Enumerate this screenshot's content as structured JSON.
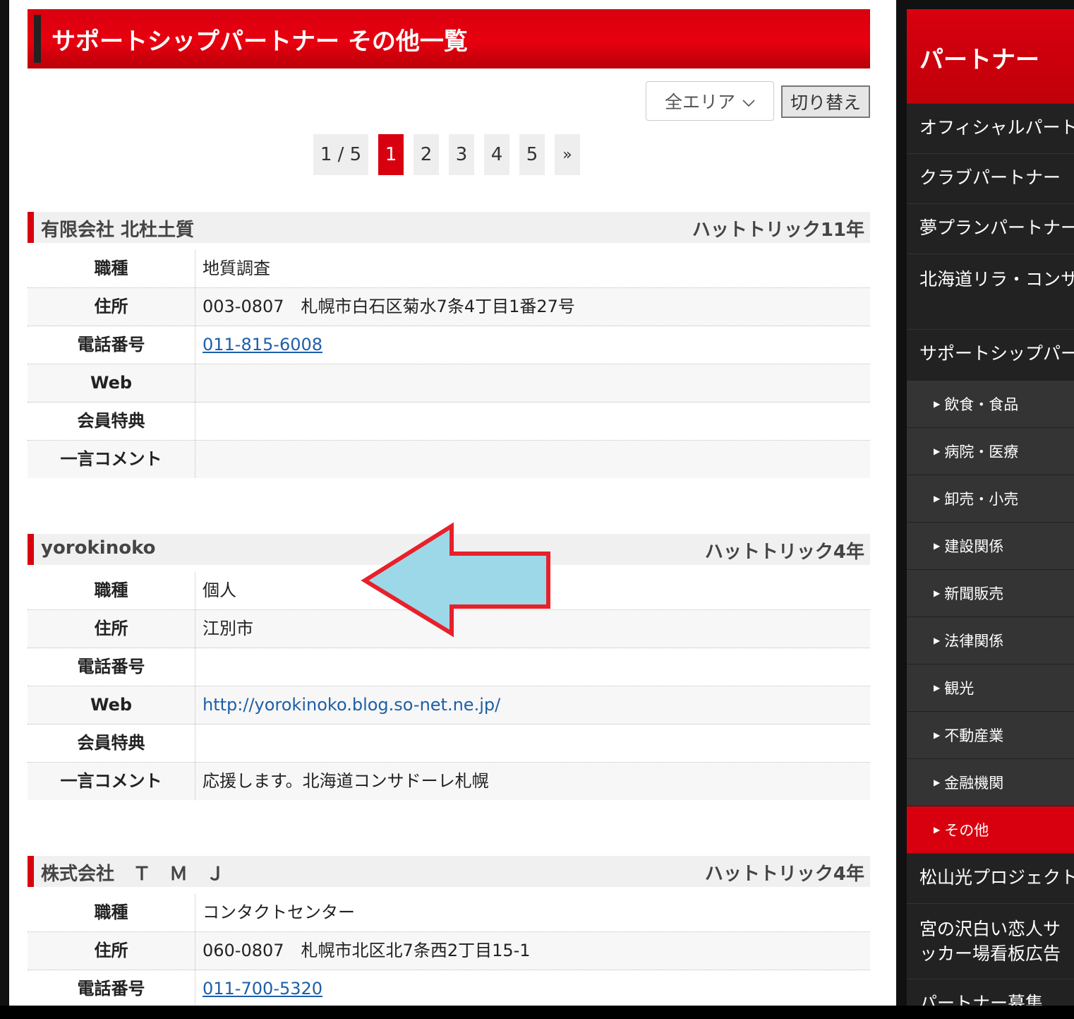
{
  "main": {
    "title": "サポートシップパートナー その他一覧",
    "area_select": "全エリア",
    "switch_button": "切り替え",
    "pagination": {
      "info": "1 / 5",
      "pages": [
        "1",
        "2",
        "3",
        "4",
        "5"
      ],
      "next": "»"
    },
    "entries": [
      {
        "name": "有限会社 北杜土質",
        "rank": "ハットトリック11年",
        "rows": [
          {
            "label": "職種",
            "value": "地質調査"
          },
          {
            "label": "住所",
            "value": "003-0807　札幌市白石区菊水7条4丁目1番27号"
          },
          {
            "label": "電話番号",
            "value": "011-815-6008"
          },
          {
            "label": "Web",
            "value": ""
          },
          {
            "label": "会員特典",
            "value": ""
          },
          {
            "label": "一言コメント",
            "value": ""
          }
        ]
      },
      {
        "name": "yorokinoko",
        "rank": "ハットトリック4年",
        "rows": [
          {
            "label": "職種",
            "value": "個人"
          },
          {
            "label": "住所",
            "value": "江別市"
          },
          {
            "label": "電話番号",
            "value": ""
          },
          {
            "label": "Web",
            "value": "http://yorokinoko.blog.so-net.ne.jp/"
          },
          {
            "label": "会員特典",
            "value": ""
          },
          {
            "label": "一言コメント",
            "value": "応援します。北海道コンサドーレ札幌"
          }
        ]
      },
      {
        "name": "株式会社　Ｔ　Ｍ　Ｊ",
        "rank": "ハットトリック4年",
        "rows": [
          {
            "label": "職種",
            "value": "コンタクトセンター"
          },
          {
            "label": "住所",
            "value": "060-0807　札幌市北区北7条西2丁目15-1"
          },
          {
            "label": "電話番号",
            "value": "011-700-5320"
          }
        ]
      }
    ]
  },
  "sidebar": {
    "heading": "パートナー",
    "items": [
      "オフィシャルパートナー",
      "クラブパートナー",
      "夢プランパートナー",
      "北海道リラ・コンサ・パートナー",
      "サポートシップパートナー"
    ],
    "subitems": [
      "飲食・食品",
      "病院・医療",
      "卸売・小売",
      "建設関係",
      "新聞販売",
      "法律関係",
      "観光",
      "不動産業",
      "金融機関",
      "その他"
    ],
    "items_after": [
      "松山光プロジェクト",
      "宮の沢白い恋人サッカー場看板広告",
      "パートナー募集"
    ]
  },
  "colors": {
    "accent": "#d8000f",
    "link": "#1d5fa8",
    "arrow_fill": "#9dd8e8",
    "arrow_stroke": "#e8202a"
  }
}
